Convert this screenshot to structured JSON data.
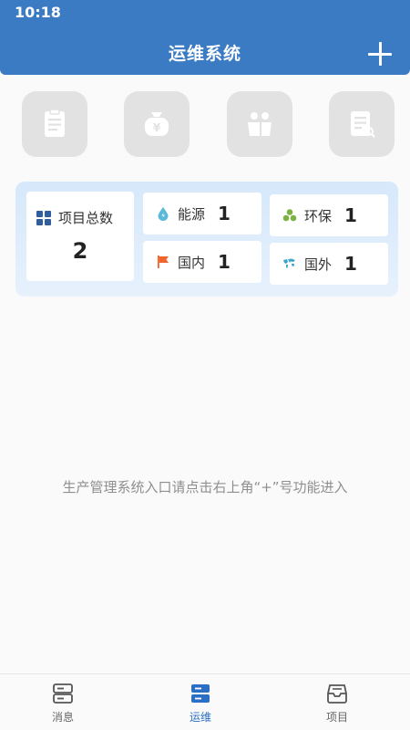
{
  "status_bar": {
    "time": "10:18"
  },
  "header": {
    "title": "运维系统"
  },
  "quick_tiles": [
    {
      "icon": "clipboard-icon"
    },
    {
      "icon": "money-bag-icon"
    },
    {
      "icon": "people-icon"
    },
    {
      "icon": "document-search-icon"
    }
  ],
  "stats": {
    "total": {
      "label": "项目总数",
      "value": "2",
      "icon": "grid-icon"
    },
    "energy": {
      "label": "能源",
      "value": "1",
      "icon": "water-drop-icon",
      "color": "#5ab8d8"
    },
    "environment": {
      "label": "环保",
      "value": "1",
      "icon": "recycle-icon",
      "color": "#7bb342"
    },
    "domestic": {
      "label": "国内",
      "value": "1",
      "icon": "flag-icon",
      "color": "#f0642e"
    },
    "overseas": {
      "label": "国外",
      "value": "1",
      "icon": "world-map-icon",
      "color": "#3aa6c8"
    }
  },
  "hint": "生产管理系统入口请点击右上角“+”号功能进入",
  "bottom_nav": [
    {
      "label": "消息",
      "icon": "messages-icon",
      "active": false
    },
    {
      "label": "运维",
      "icon": "operations-icon",
      "active": true
    },
    {
      "label": "项目",
      "icon": "inbox-icon",
      "active": false
    }
  ],
  "colors": {
    "header": "#3b7bc4",
    "accent": "#2a6fc4",
    "tile": "#e2e2e2",
    "card_bg": "#d6e8fb"
  }
}
